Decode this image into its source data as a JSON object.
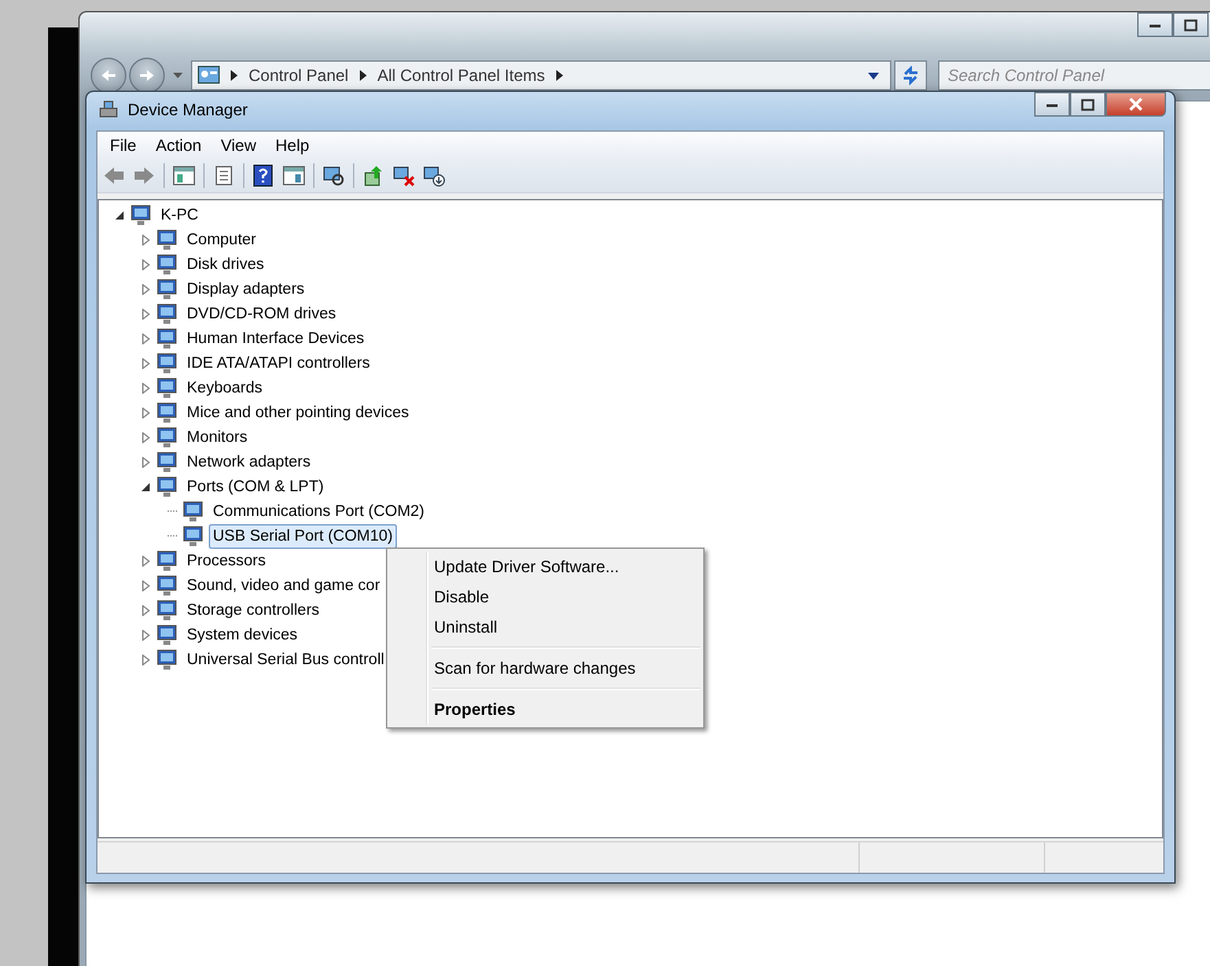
{
  "explorer_window": {
    "breadcrumbs": [
      "Control Panel",
      "All Control Panel Items"
    ],
    "search": {
      "placeholder": "Search Control Panel"
    }
  },
  "window": {
    "title": "Device Manager"
  },
  "menu_bar": [
    "File",
    "Action",
    "View",
    "Help"
  ],
  "tree": {
    "label": "K-PC",
    "expanded": true,
    "selected": false,
    "children": [
      {
        "label": "Computer",
        "expanded": false,
        "selected": false
      },
      {
        "label": "Disk drives",
        "expanded": false,
        "selected": false
      },
      {
        "label": "Display adapters",
        "expanded": false,
        "selected": false
      },
      {
        "label": "DVD/CD-ROM drives",
        "expanded": false,
        "selected": false
      },
      {
        "label": "Human Interface Devices",
        "expanded": false,
        "selected": false
      },
      {
        "label": "IDE ATA/ATAPI controllers",
        "expanded": false,
        "selected": false
      },
      {
        "label": "Keyboards",
        "expanded": false,
        "selected": false
      },
      {
        "label": "Mice and other pointing devices",
        "expanded": false,
        "selected": false
      },
      {
        "label": "Monitors",
        "expanded": false,
        "selected": false
      },
      {
        "label": "Network adapters",
        "expanded": false,
        "selected": false
      },
      {
        "label": "Ports (COM & LPT)",
        "expanded": true,
        "selected": false,
        "children": [
          {
            "label": "Communications Port (COM2)",
            "selected": false
          },
          {
            "label": "USB Serial Port (COM10)",
            "selected": true
          }
        ]
      },
      {
        "label": "Processors",
        "expanded": false,
        "selected": false
      },
      {
        "label": "Sound, video and game cor",
        "expanded": false,
        "selected": false
      },
      {
        "label": "Storage controllers",
        "expanded": false,
        "selected": false
      },
      {
        "label": "System devices",
        "expanded": false,
        "selected": false
      },
      {
        "label": "Universal Serial Bus controll",
        "expanded": false,
        "selected": false
      }
    ]
  },
  "context_menu": [
    {
      "kind": "item",
      "label": "Update Driver Software...",
      "default": false
    },
    {
      "kind": "item",
      "label": "Disable",
      "default": false
    },
    {
      "kind": "item",
      "label": "Uninstall",
      "default": false
    },
    {
      "kind": "separator"
    },
    {
      "kind": "item",
      "label": "Scan for hardware changes",
      "default": false
    },
    {
      "kind": "separator"
    },
    {
      "kind": "item",
      "label": "Properties",
      "default": true
    }
  ]
}
